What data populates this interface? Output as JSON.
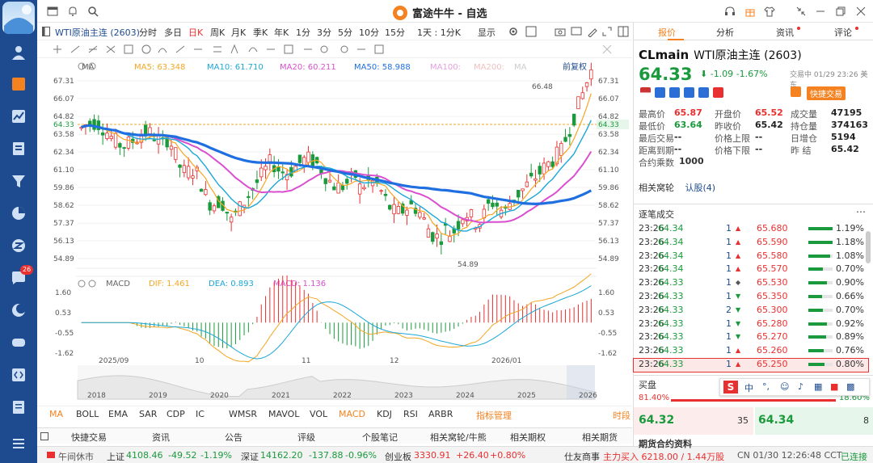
{
  "app": {
    "title": "富途牛牛 - 自选"
  },
  "sidebar": {
    "badge": "26"
  },
  "toolbar": {
    "symbol": "WTI原油主连 (2603)",
    "periods": [
      "分时",
      "多日",
      "日K",
      "周K",
      "月K",
      "季K",
      "年K",
      "1分",
      "3分",
      "5分",
      "10分",
      "15分",
      "1天 : 1分K"
    ],
    "active_period": "日K",
    "display": "显示"
  },
  "ma": {
    "label": "MA",
    "ma5": "MA5: 63.348",
    "ma10": "MA10: 61.710",
    "ma20": "MA20: 60.211",
    "ma50": "MA50: 58.988",
    "ma100": "MA100:",
    "ma200": "MA200:",
    "ma_extra": "MA",
    "adj": "前复权"
  },
  "macd": {
    "label": "MACD",
    "dif": "DIF: 1.461",
    "dea": "DEA: 0.893",
    "macd": "MACD: 1.136"
  },
  "colors": {
    "ma5": "#f5a623",
    "ma10": "#1ba7d6",
    "ma20": "#d94fd0",
    "ma50": "#1f6fe0",
    "up": "#e93030",
    "down": "#1a9a3c",
    "accent": "#f58220"
  },
  "price_axis": [
    "67.31",
    "66.07",
    "64.82",
    "63.58",
    "62.34",
    "61.10",
    "59.86",
    "58.62",
    "57.37",
    "56.13",
    "54.89"
  ],
  "macd_axis": [
    "1.60",
    "0.53",
    "-0.55",
    "-1.62"
  ],
  "current_price_tag": "64.33",
  "high_label": "66.48",
  "low_label": "54.89",
  "date_axis": [
    "2025/09",
    "10",
    "11",
    "12",
    "2026/01"
  ],
  "overview_axis": [
    "2018",
    "2019",
    "2020",
    "2021",
    "2022",
    "2023",
    "2024",
    "2025",
    "2026"
  ],
  "indicators": [
    "MA",
    "BOLL",
    "EMA",
    "SAR",
    "CDP",
    "IC",
    "WMSR",
    "MAVOL",
    "VOL",
    "MACD",
    "KDJ",
    "RSI",
    "ARBR"
  ],
  "active_indicators": [
    "MA",
    "MACD"
  ],
  "indicator_manage": "指标管理",
  "time_label": "时段",
  "news_tabs": [
    "快捷交易",
    "资讯",
    "公告",
    "评级",
    "个股笔记",
    "相关窝轮/牛熊",
    "相关期权",
    "相关期货"
  ],
  "right_tabs": [
    "报价",
    "分析",
    "资讯",
    "评论"
  ],
  "quote": {
    "code": "CLmain",
    "name": "WTI原油主连 (2603)",
    "price": "64.33",
    "change": "-1.09",
    "change_pct": "-1.67%",
    "time": "交易中 01/29 23:26 美东",
    "fast_trade": "快捷交易",
    "fields": [
      [
        "最高价",
        "65.87",
        "开盘价",
        "65.52",
        "成交量",
        "47195"
      ],
      [
        "最低价",
        "63.64",
        "昨收价",
        "65.42",
        "持仓量",
        "374163"
      ],
      [
        "最后交易",
        "--",
        "价格上限",
        "--",
        "日增仓",
        "5194"
      ],
      [
        "距离到期",
        "--",
        "价格下限",
        "--",
        "昨 结",
        "65.42"
      ]
    ],
    "multiplier_label": "合约乘数",
    "multiplier": "1000",
    "related1": "相关窝轮",
    "related2": "认股(4)"
  },
  "trades_title": "逐笔成交",
  "trades": [
    [
      "23:26",
      "64.34",
      "1",
      "65.680",
      "1.19%"
    ],
    [
      "23:26",
      "64.34",
      "1",
      "65.590",
      "1.18%"
    ],
    [
      "23:26",
      "64.34",
      "1",
      "65.580",
      "1.08%"
    ],
    [
      "23:26",
      "64.34",
      "1",
      "65.570",
      "0.70%"
    ],
    [
      "23:26",
      "64.33",
      "1",
      "65.530",
      "0.90%"
    ],
    [
      "23:26",
      "64.33",
      "1",
      "65.350",
      "0.66%"
    ],
    [
      "23:26",
      "64.33",
      "2",
      "65.300",
      "0.70%"
    ],
    [
      "23:26",
      "64.33",
      "1",
      "65.280",
      "0.92%"
    ],
    [
      "23:26",
      "64.33",
      "1",
      "65.270",
      "0.89%"
    ],
    [
      "23:26",
      "64.33",
      "1",
      "65.260",
      "0.76%"
    ],
    [
      "23:26",
      "64.33",
      "1",
      "65.250",
      "0.80%"
    ]
  ],
  "buy": {
    "title": "买盘",
    "left_pct": "81.40%",
    "right_pct": "18.60%",
    "bid": "64.32",
    "bid_qty": "35",
    "ask": "64.34",
    "ask_qty": "8"
  },
  "bottom_label": "期货合约资料",
  "status": {
    "market": "午间休市",
    "sh": "上证",
    "sh_val": "4108.46",
    "sh_chg": "-49.52",
    "sh_pct": "-1.19%",
    "sz": "深证",
    "sz_val": "14162.20",
    "sz_chg": "-137.88",
    "sz_pct": "-0.96%",
    "cy": "创业板",
    "cy_val": "3330.91",
    "cy_chg": "+26.40",
    "cy_pct": "+0.80%",
    "broker": "仕友商事",
    "flow": "主力买入 6218.00 / 1.44万股",
    "clock": "CN 01/30 12:26:48 CCT",
    "conn": "已连接"
  },
  "ime": {
    "mode": "中"
  }
}
